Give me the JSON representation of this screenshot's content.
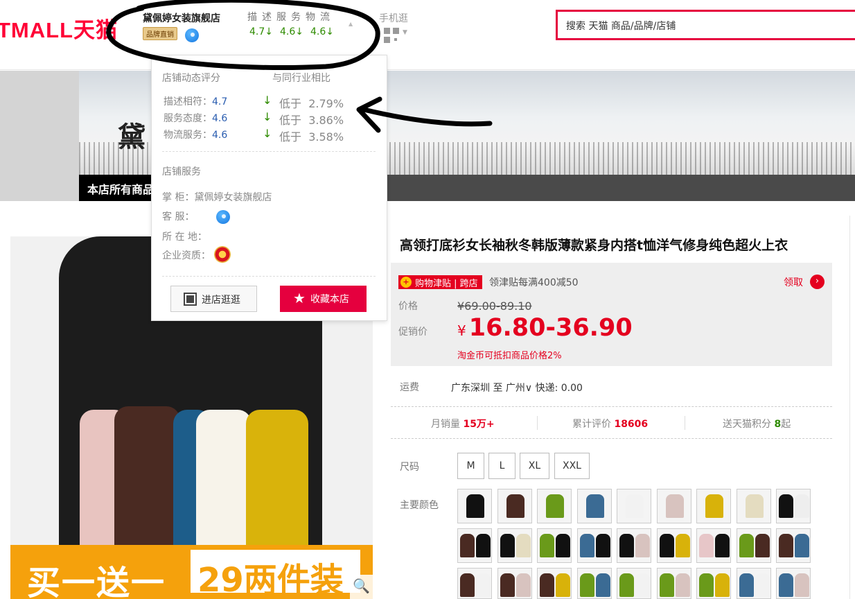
{
  "header": {
    "logo": "TMALL天猫",
    "shop_name": "黛佩婷女装旗舰店",
    "shop_badge": "品牌直销",
    "dsr_labels": "描述服务物流",
    "dsr_values": [
      "4.7↓",
      "4.6↓",
      "4.6↓"
    ],
    "mobile_label": "手机逛",
    "search_placeholder": "搜索 天猫 商品/品牌/店铺"
  },
  "banner": {
    "title_partial": "黛",
    "all_goods": "本店所有商品"
  },
  "popup": {
    "rating_title": "店铺动态评分",
    "compare_title": "与同行业相比",
    "ratings": [
      {
        "label": "描述相符：",
        "value": "4.7",
        "arrow": "↓",
        "comparison": "低于",
        "percent": "2.79%"
      },
      {
        "label": "服务态度：",
        "value": "4.6",
        "arrow": "↓",
        "comparison": "低于",
        "percent": "3.86%"
      },
      {
        "label": "物流服务：",
        "value": "4.6",
        "arrow": "↓",
        "comparison": "低于",
        "percent": "3.58%"
      }
    ],
    "service_title": "店铺服务",
    "keeper_label": "掌 柜：",
    "keeper_value": "黛佩婷女装旗舰店",
    "cs_label": "客 服：",
    "location_label": "所 在 地：",
    "qualification_label": "企业资质：",
    "enter_label": "进店逛逛",
    "fav_label": "收藏本店"
  },
  "product_image": {
    "promo_a": "买一送一",
    "promo_b": "29两件装"
  },
  "product": {
    "title": "高领打底衫女长袖秋冬韩版薄款紧身内搭t恤洋气修身纯色超火上衣",
    "coupon_tag": "购物津贴 | 跨店",
    "coupon_text": "领津贴每满400减50",
    "claim": "领取",
    "price_label": "价格",
    "original_price": "¥69.00-89.10",
    "promo_label": "促销价",
    "currency": "¥",
    "promo_price": "16.80-36.90",
    "coin_note": "淘金币可抵扣商品价格2%",
    "shipping_label": "运费",
    "shipping_value": "广东深圳 至 广州∨ 快递: 0.00",
    "monthly_label": "月销量",
    "monthly_value": "15万+",
    "reviews_label": "累计评价",
    "reviews_value": "18606",
    "points_label": "送天猫积分",
    "points_value": "8",
    "points_suffix": "起",
    "size_label": "尺码",
    "sizes": [
      "M",
      "L",
      "XL",
      "XXL"
    ],
    "color_label": "主要颜色"
  },
  "colors": {
    "accent": "#ff0036",
    "price": "#e4001f",
    "dsr_green": "#2e8b00",
    "promo_orange": "#f5a10c"
  }
}
